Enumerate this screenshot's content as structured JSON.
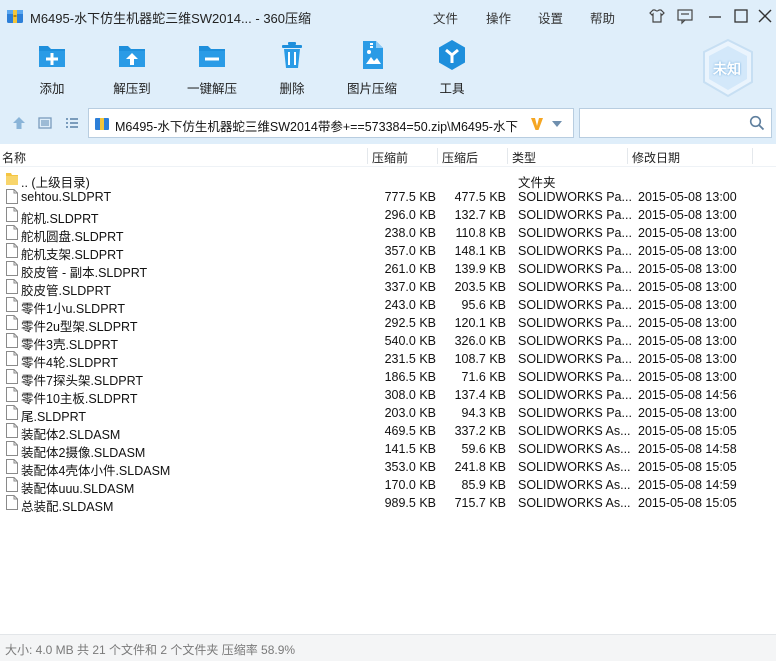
{
  "window": {
    "title": "M6495-水下仿生机器蛇三维SW2014... - 360压缩",
    "menus": [
      "文件",
      "操作",
      "设置",
      "帮助"
    ],
    "controls": [
      "skin-icon",
      "feedback-icon",
      "minimize-icon",
      "maximize-icon",
      "close-icon"
    ]
  },
  "toolbar": {
    "buttons": [
      {
        "label": "添加",
        "icon": "add-icon"
      },
      {
        "label": "解压到",
        "icon": "extract-to-icon"
      },
      {
        "label": "一键解压",
        "icon": "one-click-extract-icon"
      },
      {
        "label": "删除",
        "icon": "delete-icon"
      },
      {
        "label": "图片压缩",
        "icon": "image-compress-icon"
      },
      {
        "label": "工具",
        "icon": "tools-icon"
      }
    ],
    "badge": "未知"
  },
  "address": {
    "path": "M6495-水下仿生机器蛇三维SW2014带参+==573384=50.zip\\M6495-水下",
    "search_placeholder": ""
  },
  "columns": {
    "name": "名称",
    "original": "压缩前",
    "compressed": "压缩后",
    "type": "类型",
    "modified": "修改日期"
  },
  "rows": [
    {
      "name": ".. (上级目录)",
      "original": "",
      "compressed": "",
      "type": "文件夹",
      "modified": "",
      "icon": "folder"
    },
    {
      "name": "sehtou.SLDPRT",
      "original": "777.5 KB",
      "compressed": "477.5 KB",
      "type": "SOLIDWORKS Pa...",
      "modified": "2015-05-08 13:00",
      "icon": "file"
    },
    {
      "name": "舵机.SLDPRT",
      "original": "296.0 KB",
      "compressed": "132.7 KB",
      "type": "SOLIDWORKS Pa...",
      "modified": "2015-05-08 13:00",
      "icon": "file"
    },
    {
      "name": "舵机圆盘.SLDPRT",
      "original": "238.0 KB",
      "compressed": "110.8 KB",
      "type": "SOLIDWORKS Pa...",
      "modified": "2015-05-08 13:00",
      "icon": "file"
    },
    {
      "name": "舵机支架.SLDPRT",
      "original": "357.0 KB",
      "compressed": "148.1 KB",
      "type": "SOLIDWORKS Pa...",
      "modified": "2015-05-08 13:00",
      "icon": "file"
    },
    {
      "name": "胶皮管 - 副本.SLDPRT",
      "original": "261.0 KB",
      "compressed": "139.9 KB",
      "type": "SOLIDWORKS Pa...",
      "modified": "2015-05-08 13:00",
      "icon": "file"
    },
    {
      "name": "胶皮管.SLDPRT",
      "original": "337.0 KB",
      "compressed": "203.5 KB",
      "type": "SOLIDWORKS Pa...",
      "modified": "2015-05-08 13:00",
      "icon": "file"
    },
    {
      "name": "零件1小u.SLDPRT",
      "original": "243.0 KB",
      "compressed": "95.6 KB",
      "type": "SOLIDWORKS Pa...",
      "modified": "2015-05-08 13:00",
      "icon": "file"
    },
    {
      "name": "零件2u型架.SLDPRT",
      "original": "292.5 KB",
      "compressed": "120.1 KB",
      "type": "SOLIDWORKS Pa...",
      "modified": "2015-05-08 13:00",
      "icon": "file"
    },
    {
      "name": "零件3壳.SLDPRT",
      "original": "540.0 KB",
      "compressed": "326.0 KB",
      "type": "SOLIDWORKS Pa...",
      "modified": "2015-05-08 13:00",
      "icon": "file"
    },
    {
      "name": "零件4轮.SLDPRT",
      "original": "231.5 KB",
      "compressed": "108.7 KB",
      "type": "SOLIDWORKS Pa...",
      "modified": "2015-05-08 13:00",
      "icon": "file"
    },
    {
      "name": "零件7探头架.SLDPRT",
      "original": "186.5 KB",
      "compressed": "71.6 KB",
      "type": "SOLIDWORKS Pa...",
      "modified": "2015-05-08 13:00",
      "icon": "file"
    },
    {
      "name": "零件10主板.SLDPRT",
      "original": "308.0 KB",
      "compressed": "137.4 KB",
      "type": "SOLIDWORKS Pa...",
      "modified": "2015-05-08 14:56",
      "icon": "file"
    },
    {
      "name": "尾.SLDPRT",
      "original": "203.0 KB",
      "compressed": "94.3 KB",
      "type": "SOLIDWORKS Pa...",
      "modified": "2015-05-08 13:00",
      "icon": "file"
    },
    {
      "name": "装配体2.SLDASM",
      "original": "469.5 KB",
      "compressed": "337.2 KB",
      "type": "SOLIDWORKS As...",
      "modified": "2015-05-08 15:05",
      "icon": "file"
    },
    {
      "name": "装配体2摄像.SLDASM",
      "original": "141.5 KB",
      "compressed": "59.6 KB",
      "type": "SOLIDWORKS As...",
      "modified": "2015-05-08 14:58",
      "icon": "file"
    },
    {
      "name": "装配体4壳体小件.SLDASM",
      "original": "353.0 KB",
      "compressed": "241.8 KB",
      "type": "SOLIDWORKS As...",
      "modified": "2015-05-08 15:05",
      "icon": "file"
    },
    {
      "name": "装配体uuu.SLDASM",
      "original": "170.0 KB",
      "compressed": "85.9 KB",
      "type": "SOLIDWORKS As...",
      "modified": "2015-05-08 14:59",
      "icon": "file"
    },
    {
      "name": "总装配.SLDASM",
      "original": "989.5 KB",
      "compressed": "715.7 KB",
      "type": "SOLIDWORKS As...",
      "modified": "2015-05-08 15:05",
      "icon": "file"
    }
  ],
  "status": {
    "text": "大小: 4.0 MB 共 21 个文件和 2 个文件夹 压缩率 58.9%"
  },
  "colors": {
    "accent": "#1e8fdc",
    "chrome": "#dfeefa",
    "folder": "#f5c542",
    "v_badge": "#f5a623"
  }
}
